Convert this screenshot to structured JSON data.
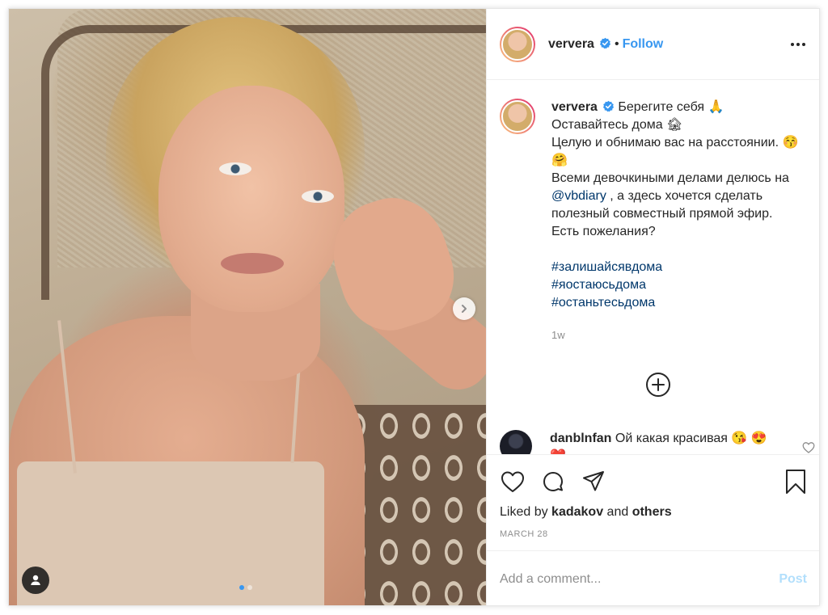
{
  "post": {
    "username": "ververa",
    "follow_label": "Follow",
    "separator": "•",
    "icons": {
      "verified": "verified-badge-icon",
      "more": "more-options-icon",
      "next": "chevron-right-icon",
      "tag": "user-tag-icon",
      "load_more": "plus-circle-icon",
      "like": "heart-icon",
      "comment": "comment-bubble-icon",
      "share": "paper-plane-icon",
      "save": "bookmark-icon"
    },
    "colors": {
      "accent": "#3897f0",
      "link": "#00376b",
      "muted": "#8e8e8e"
    }
  },
  "caption": {
    "username": "ververa",
    "line1": "Берегите себя 🙏",
    "line2": "Оставайтесь дома 🏚",
    "line3": "Целую и обнимаю вас на расстоянии. 😚 🤗",
    "line4_before": "Всеми девочкиными делами делюсь на ",
    "mention": "@vbdiary",
    "line4_after": " , а здесь хочется сделать полезный совместный прямой эфир. Есть пожелания?",
    "hashtags": [
      "#залишайсявдома",
      "#яостаюсьдома",
      "#останьтесьдома"
    ],
    "time_ago": "1w"
  },
  "comment": {
    "username": "danblnfan",
    "text": "Ой какая красивая 😘 😍 ❤️"
  },
  "engagement": {
    "liked_by_prefix": "Liked by ",
    "liked_by_user": "kadakov",
    "liked_by_mid": " and ",
    "liked_by_others": "others",
    "date": "MARCH 28"
  },
  "comment_form": {
    "placeholder": "Add a comment...",
    "post_label": "Post"
  },
  "carousel": {
    "current": 1,
    "total": 2
  }
}
